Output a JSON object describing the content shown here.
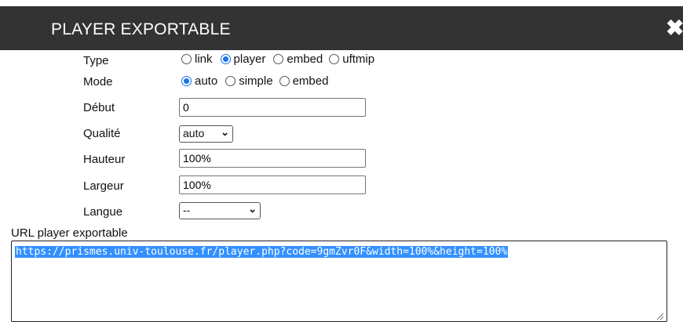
{
  "dialog": {
    "title": "PLAYER EXPORTABLE",
    "close_symbol": "✖"
  },
  "form": {
    "type": {
      "label": "Type",
      "options": [
        "link",
        "player",
        "embed",
        "uftmip"
      ],
      "selected": "player"
    },
    "mode": {
      "label": "Mode",
      "options": [
        "auto",
        "simple",
        "embed"
      ],
      "selected": "auto"
    },
    "debut": {
      "label": "Début",
      "value": "0"
    },
    "qualite": {
      "label": "Qualité",
      "selected": "auto"
    },
    "hauteur": {
      "label": "Hauteur",
      "value": "100%"
    },
    "largeur": {
      "label": "Largeur",
      "value": "100%"
    },
    "langue": {
      "label": "Langue",
      "selected": "--"
    }
  },
  "url": {
    "label": "URL player exportable",
    "value": "https://prismes.univ-toulouse.fr/player.php?code=9gmZvr0F&width=100%&height=100%"
  },
  "colors": {
    "titlebar": "#333333",
    "radio_accent": "#1a73e8",
    "selection": "#3390ff"
  }
}
